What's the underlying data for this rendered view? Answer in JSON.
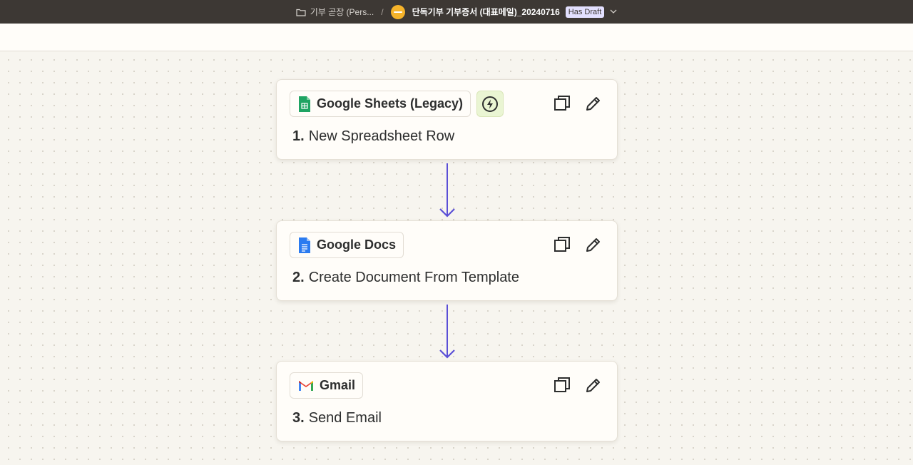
{
  "topbar": {
    "folder_label": "기부 곧장 (Pers...",
    "separator": "/",
    "zap_title": "단독기부 기부증서 (대표메일)_20240716",
    "draft_badge": "Has Draft"
  },
  "colors": {
    "topbar_bg": "#3d3834",
    "connector": "#5a4fd6",
    "trigger_bg": "#eaf5d3"
  },
  "steps": [
    {
      "app_name": "Google Sheets (Legacy)",
      "app_icon": "google-sheets-icon",
      "number": "1.",
      "title": "New Spreadsheet Row",
      "is_trigger": true
    },
    {
      "app_name": "Google Docs",
      "app_icon": "google-docs-icon",
      "number": "2.",
      "title": "Create Document From Template",
      "is_trigger": false
    },
    {
      "app_name": "Gmail",
      "app_icon": "gmail-icon",
      "number": "3.",
      "title": "Send Email",
      "is_trigger": false
    }
  ]
}
